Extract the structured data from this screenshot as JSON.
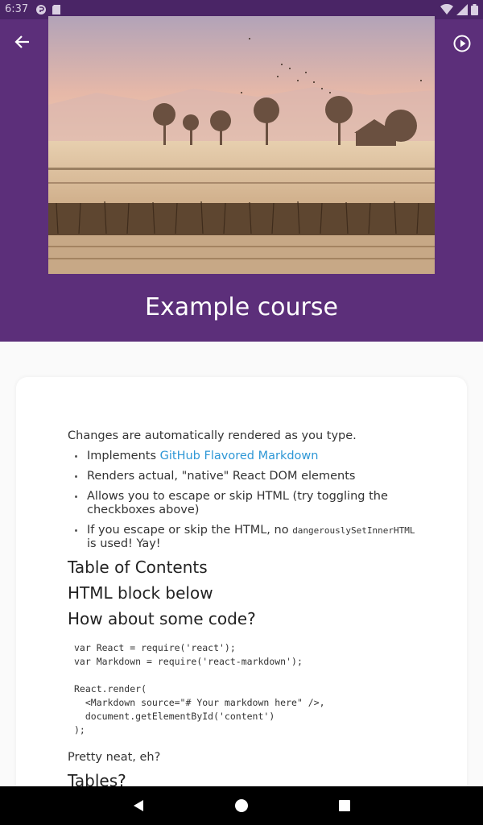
{
  "status_bar": {
    "time": "6:37"
  },
  "header": {
    "course_title": "Example course"
  },
  "content": {
    "intro": "Changes are automatically rendered as you type.",
    "bullet1_prefix": "Implements ",
    "bullet1_link": "GitHub Flavored Markdown",
    "bullet2": "Renders actual, \"native\" React DOM elements",
    "bullet3": "Allows you to escape or skip HTML (try toggling the checkboxes above)",
    "bullet4_prefix": "If you escape or skip the HTML, no ",
    "bullet4_code": "dangerouslySetInnerHTML",
    "bullet4_suffix": " is used! Yay!",
    "heading_toc": "Table of Contents",
    "heading_html": "HTML block below",
    "heading_code": "How about some code?",
    "code_block": "var React = require('react');\nvar Markdown = require('react-markdown');\n\nReact.render(\n  <Markdown source=\"# Your markdown here\" />,\n  document.getElementById('content')\n);",
    "after_code": "Pretty neat, eh?",
    "heading_tables": "Tables?"
  }
}
